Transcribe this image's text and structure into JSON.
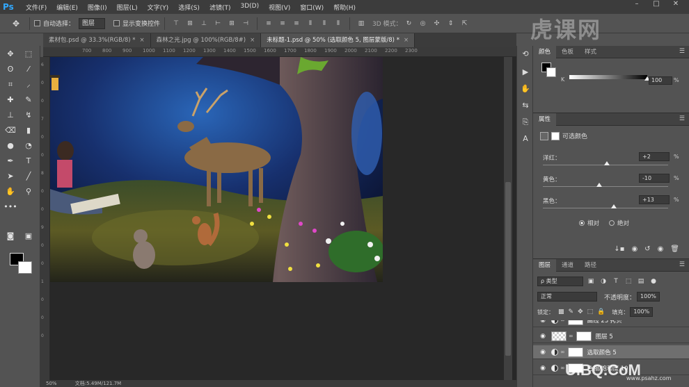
{
  "app": {
    "logo": "Ps"
  },
  "menu": [
    "文件(F)",
    "编辑(E)",
    "图像(I)",
    "图层(L)",
    "文字(Y)",
    "选择(S)",
    "滤镜(T)",
    "3D(D)",
    "视图(V)",
    "窗口(W)",
    "帮助(H)"
  ],
  "window_controls": {
    "minimize": "–",
    "maximize": "□",
    "close": "✕"
  },
  "options": {
    "auto_select_label": "自动选择：",
    "auto_select_value": "图层",
    "transform_label": "显示变换控件",
    "mode_3d": "3D 模式："
  },
  "tabs": [
    {
      "label": "素材包.psd @ 33.3%(RGB/8) *",
      "close": "×"
    },
    {
      "label": "森林之光.jpg @ 100%(RGB/8#)",
      "close": "×"
    },
    {
      "label": "未标题-1.psd @ 50% (选取颜色 5, 图层蒙版/8) *",
      "close": "×"
    }
  ],
  "ruler_top": [
    "700",
    "800",
    "900",
    "1000",
    "1100",
    "1200",
    "1300",
    "1400",
    "1500",
    "1600",
    "1700",
    "1800",
    "1900",
    "2000",
    "2100",
    "2200",
    "2300"
  ],
  "ruler_left": [
    "6",
    "0",
    "0",
    "7",
    "0",
    "0",
    "8",
    "0",
    "0",
    "9",
    "0",
    "0",
    "1",
    "0",
    "0",
    "0"
  ],
  "status": {
    "zoom": "50%",
    "doc": "文档:5.49M/121.7M"
  },
  "color_panel": {
    "tabs": [
      "颜色",
      "色板",
      "样式"
    ],
    "channel": "K",
    "value": "100",
    "unit": "%",
    "level": 1.0
  },
  "properties": {
    "tab": "属性",
    "title": "可选颜色",
    "rows": [
      {
        "label": "洋红：",
        "value": "+2",
        "unit": "%",
        "level": 0.51
      },
      {
        "label": "黄色：",
        "value": "-10",
        "unit": "%",
        "level": 0.45
      },
      {
        "label": "黑色：",
        "value": "+13",
        "unit": "%",
        "level": 0.565
      }
    ],
    "relative": "相对",
    "absolute": "绝对"
  },
  "layers": {
    "tabs": [
      "图层",
      "通道",
      "路径"
    ],
    "filter": "ρ 类型",
    "blend": "正常",
    "opacity_label": "不透明度：",
    "opacity_value": "100%",
    "lock_label": "锁定：",
    "fill_label": "填充：",
    "fill_value": "100%",
    "items": [
      {
        "name": "曲线 23 拷贝",
        "kind": "adj"
      },
      {
        "name": "图层 5",
        "kind": "pixel"
      },
      {
        "name": "选取颜色 5",
        "kind": "adj",
        "selected": true
      },
      {
        "name": "色相/饱和度 10",
        "kind": "adj"
      }
    ]
  },
  "watermark": {
    "top": "虎课网",
    "bottom": "UiBQ.CoM",
    "bottom_sub": "www.psahz.com"
  }
}
